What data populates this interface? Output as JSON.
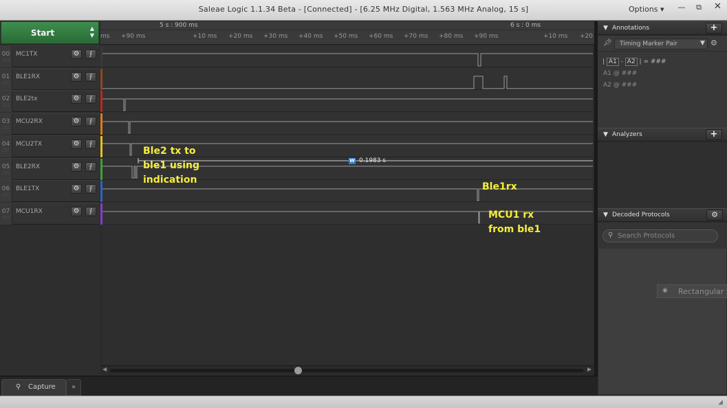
{
  "window": {
    "title": "Saleae Logic 1.1.34 Beta - [Connected] - [6.25 MHz Digital, 1.563 MHz Analog, 15 s]",
    "options_label": "Options ▾",
    "minimize": "—",
    "restore": "⧉",
    "close": "✕"
  },
  "toolbar": {
    "start_label": "Start"
  },
  "channels": [
    {
      "num": "00",
      "name": "MC1TX",
      "color": "#3a3a3a"
    },
    {
      "num": "01",
      "name": "BLE1RX",
      "color": "#8b4a1e"
    },
    {
      "num": "02",
      "name": "BLE2tx",
      "color": "#c0261e"
    },
    {
      "num": "03",
      "name": "MCU2RX",
      "color": "#e07a1b"
    },
    {
      "num": "04",
      "name": "MCU2TX",
      "color": "#e3c21d"
    },
    {
      "num": "05",
      "name": "BLE2RX",
      "color": "#3fa33a"
    },
    {
      "num": "06",
      "name": "BLE1TX",
      "color": "#2c62c9"
    },
    {
      "num": "07",
      "name": "MCU1RX",
      "color": "#8a3ac9"
    }
  ],
  "ruler": {
    "timestamps": [
      "5 s : 900 ms",
      "6 s : 0 ms"
    ],
    "ticks": [
      "ms",
      "+90 ms",
      "+10 ms",
      "+20 ms",
      "+30 ms",
      "+40 ms",
      "+50 ms",
      "+60 ms",
      "+70 ms",
      "+80 ms",
      "+90 ms",
      "+10 ms",
      "+20"
    ]
  },
  "annotations": {
    "ble2_tx": [
      "Ble2 tx to",
      "ble1 using",
      "indication"
    ],
    "ble1rx": "Ble1rx",
    "mcu1_rx": [
      "MCU1 rx",
      "from ble1"
    ]
  },
  "measurement": {
    "badge": "W",
    "value": "0.1983 s"
  },
  "bottom": {
    "capture_tab": "Capture",
    "more_tab": "»"
  },
  "right_panel": {
    "annotations_header": "Annotations",
    "timing_marker": "Timing Marker Pair",
    "formula": [
      "A1",
      "A2",
      "= ###"
    ],
    "a1_row": "A1  @  ###",
    "a2_row": "A2  @  ###",
    "analyzers_header": "Analyzers",
    "decoded_header": "Decoded Protocols",
    "search_placeholder": "Search Protocols",
    "floating_tip": "Rectangular S"
  }
}
